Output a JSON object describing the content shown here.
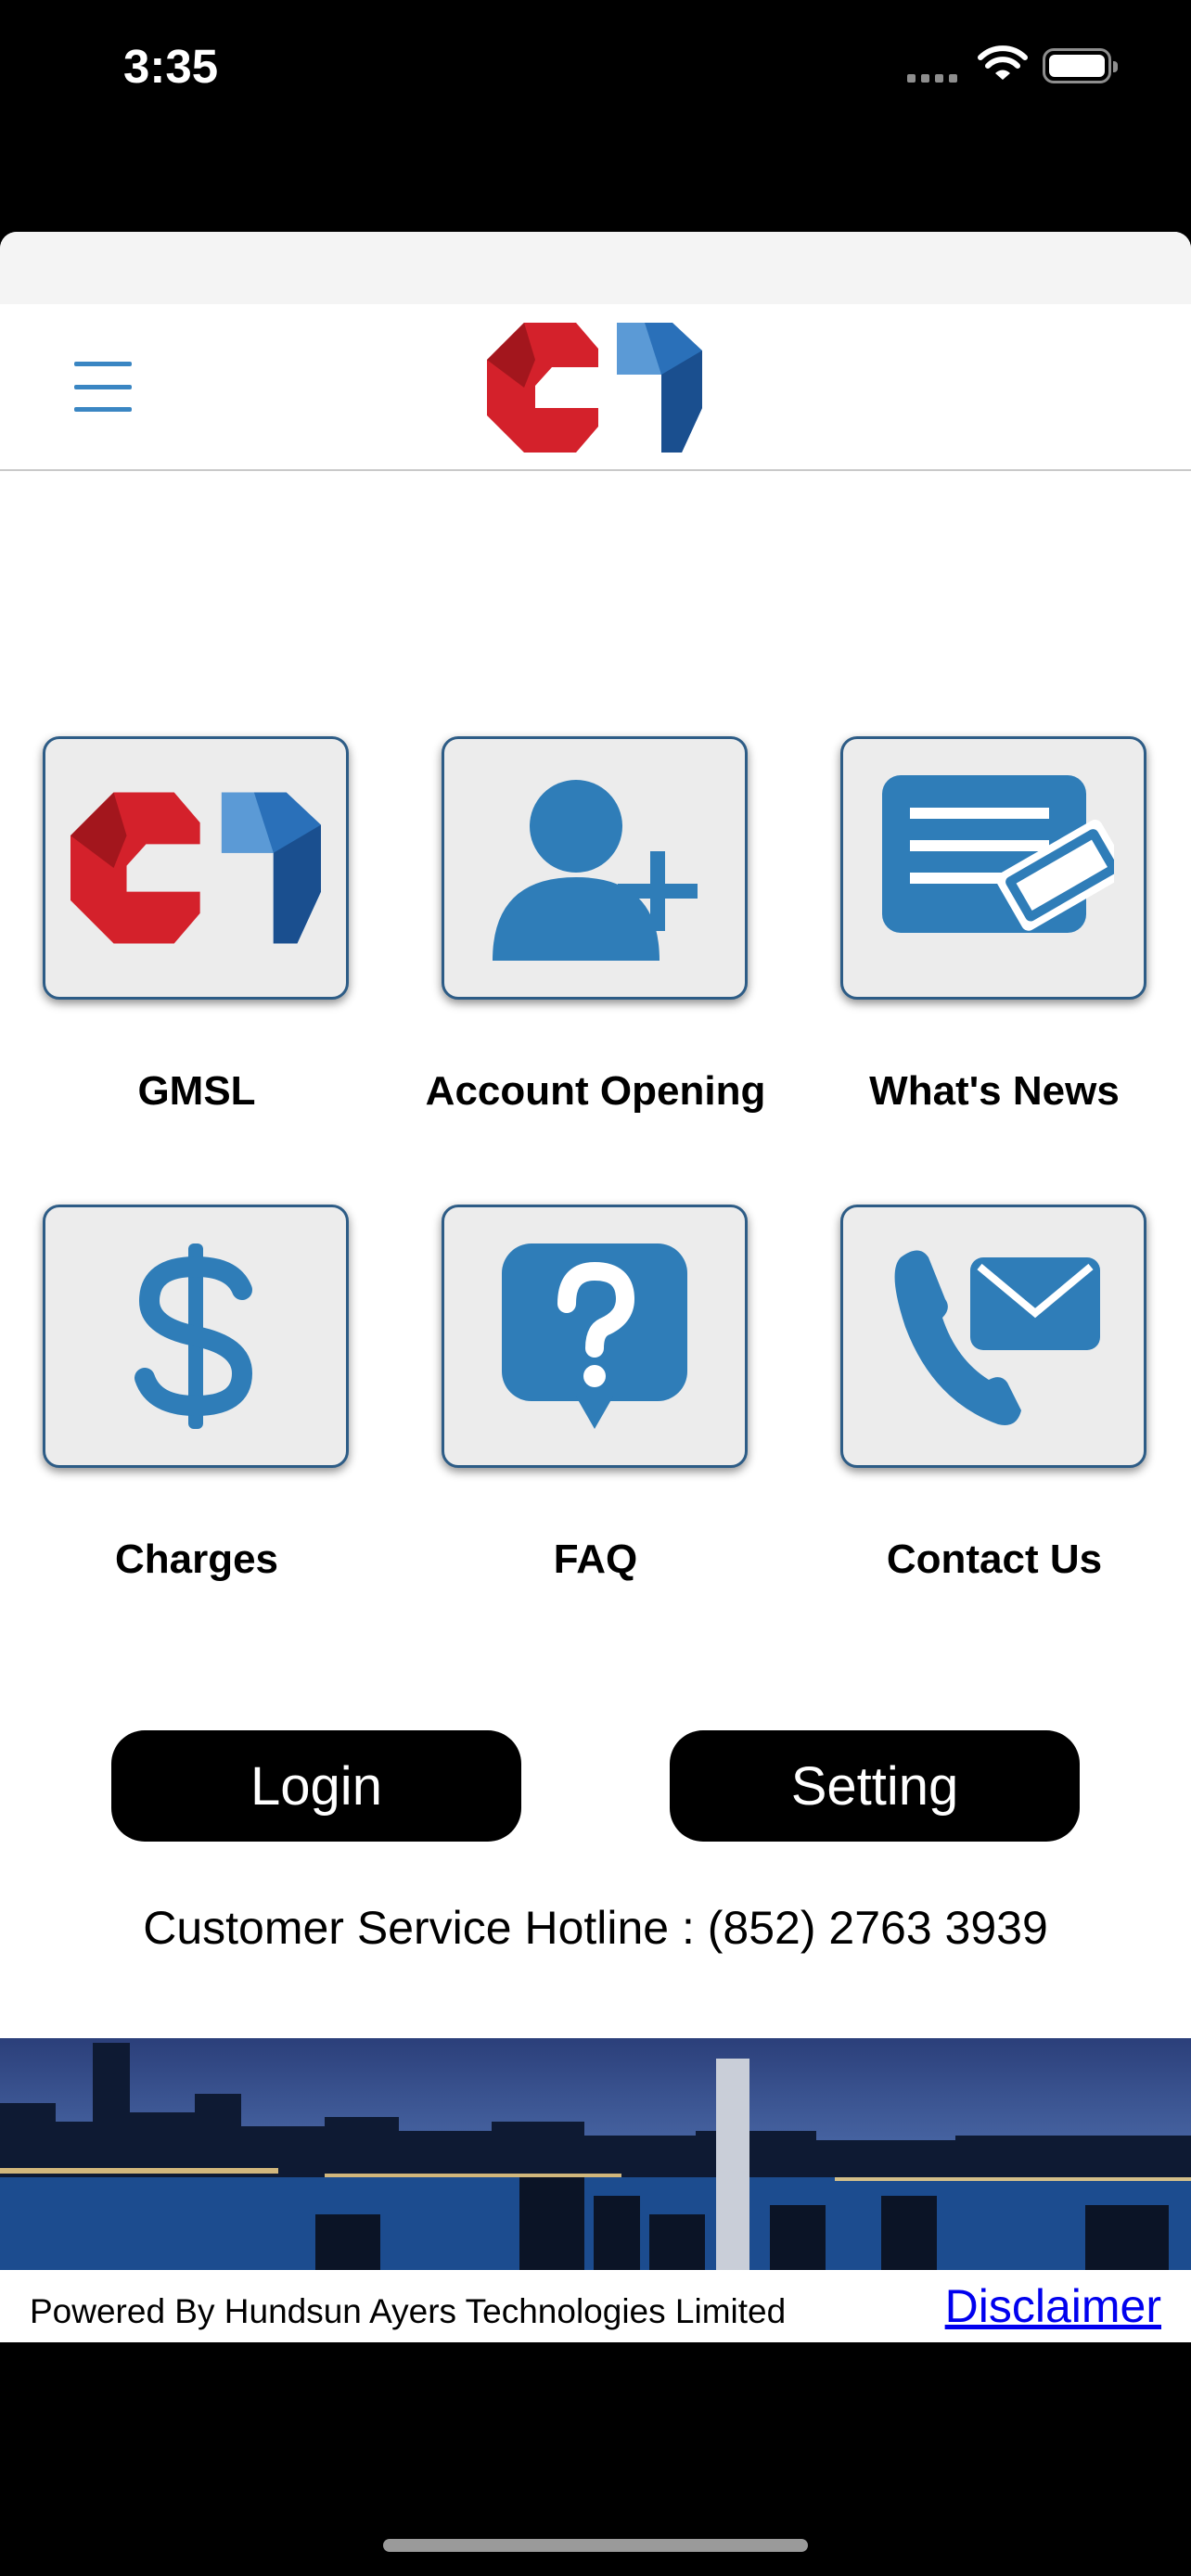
{
  "status_bar": {
    "time": "3:35"
  },
  "header": {
    "menu_icon": "hamburger-menu-icon",
    "logo": "gm-logo"
  },
  "tiles": [
    {
      "label": "GMSL",
      "icon": "gm-logo"
    },
    {
      "label": "Account Opening",
      "icon": "add-user-icon"
    },
    {
      "label": "What's News",
      "icon": "news-ticket-icon"
    },
    {
      "label": "Charges",
      "icon": "dollar-icon"
    },
    {
      "label": "FAQ",
      "icon": "question-bubble-icon"
    },
    {
      "label": "Contact Us",
      "icon": "phone-mail-icon"
    }
  ],
  "buttons": {
    "login": "Login",
    "setting": "Setting"
  },
  "hotline": "Customer Service Hotline : (852) 2763 3939",
  "footer": {
    "powered_by": "Powered By Hundsun Ayers Technologies Limited",
    "disclaimer": "Disclaimer"
  },
  "colors": {
    "accent": "#3a86c3",
    "logo_red": "#d4212b",
    "logo_blue": "#1f5fa8",
    "button": "#000000"
  }
}
